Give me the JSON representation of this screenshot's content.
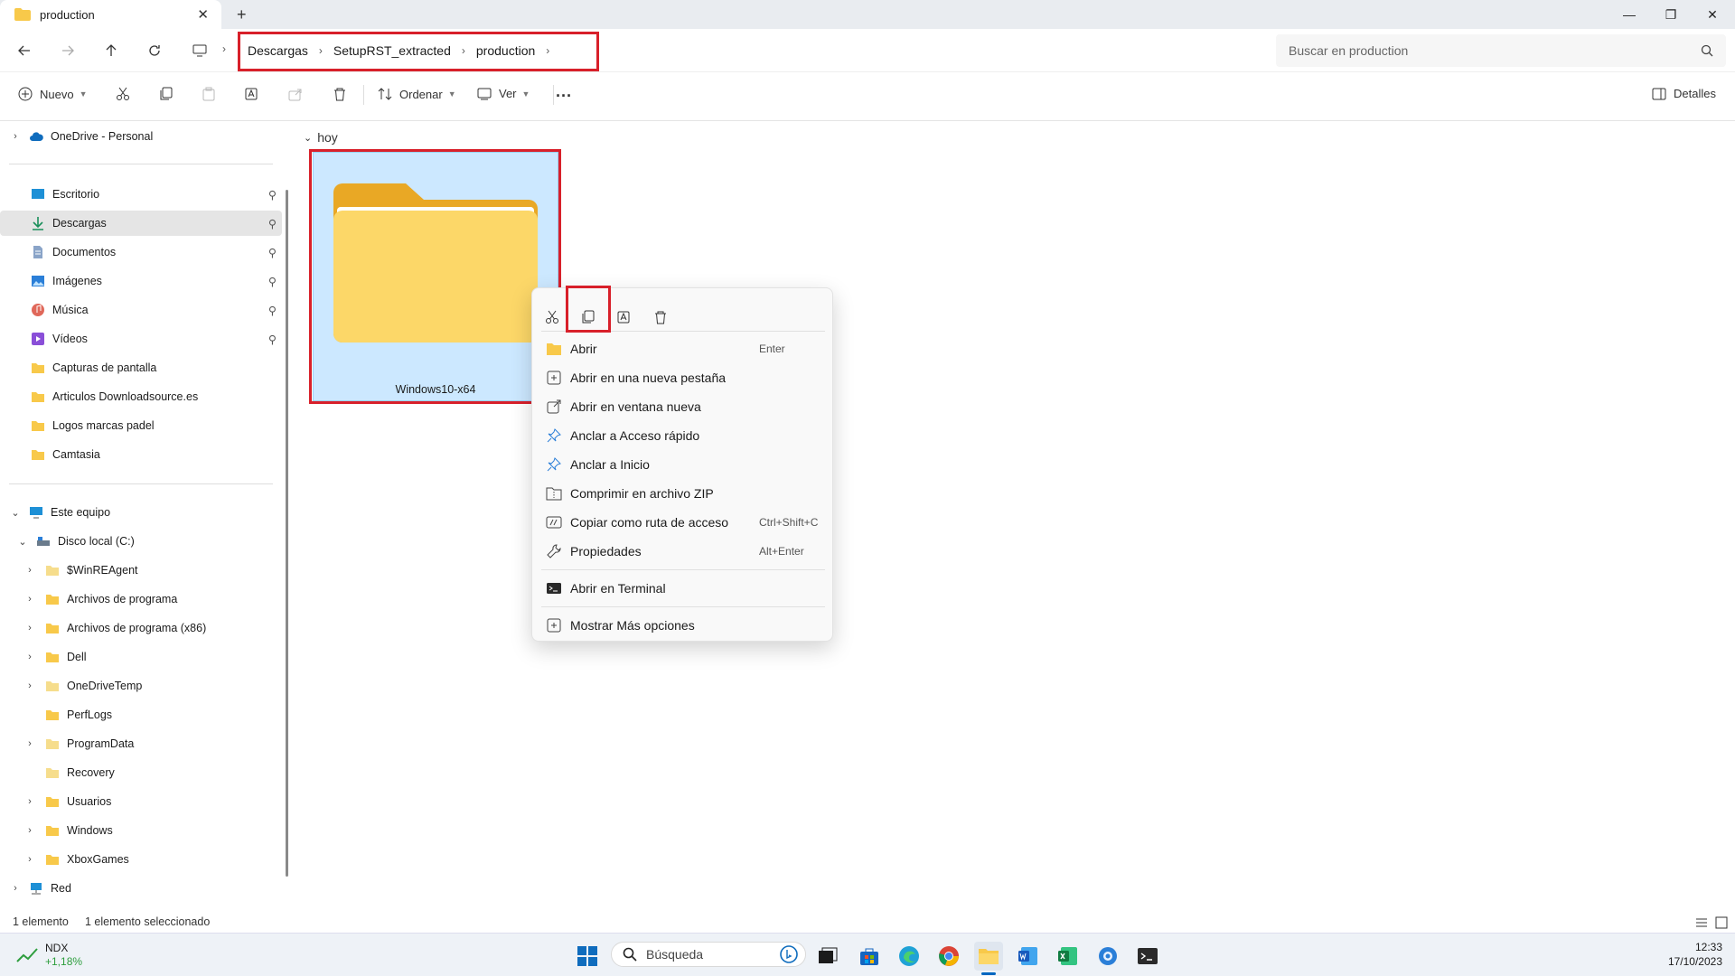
{
  "window": {
    "tab_title": "production",
    "new_tab": "+"
  },
  "breadcrumb": [
    "Descargas",
    "SetupRST_extracted",
    "production"
  ],
  "search": {
    "placeholder": "Buscar en production"
  },
  "toolbar": {
    "new_label": "Nuevo",
    "sort_label": "Ordenar",
    "view_label": "Ver",
    "details_label": "Detalles"
  },
  "sidebar": {
    "onedrive": "OneDrive - Personal",
    "quick": [
      "Escritorio",
      "Descargas",
      "Documentos",
      "Imágenes",
      "Música",
      "Vídeos",
      "Capturas de pantalla",
      "Articulos Downloadsource.es",
      "Logos marcas padel",
      "Camtasia"
    ],
    "this_pc": "Este equipo",
    "drive": "Disco local (C:)",
    "folders": [
      "$WinREAgent",
      "Archivos de programa",
      "Archivos de programa (x86)",
      "Dell",
      "OneDriveTemp",
      "PerfLogs",
      "ProgramData",
      "Recovery",
      "Usuarios",
      "Windows",
      "XboxGames"
    ],
    "network": "Red"
  },
  "content": {
    "group": "hoy",
    "item_name": "Windows10-x64"
  },
  "context_menu": {
    "items": [
      {
        "label": "Abrir",
        "shortcut": "Enter"
      },
      {
        "label": "Abrir en una nueva pestaña",
        "shortcut": ""
      },
      {
        "label": "Abrir en ventana nueva",
        "shortcut": ""
      },
      {
        "label": "Anclar a Acceso rápido",
        "shortcut": ""
      },
      {
        "label": "Anclar a Inicio",
        "shortcut": ""
      },
      {
        "label": "Comprimir en archivo ZIP",
        "shortcut": ""
      },
      {
        "label": "Copiar como ruta de acceso",
        "shortcut": "Ctrl+Shift+C"
      },
      {
        "label": "Propiedades",
        "shortcut": "Alt+Enter"
      }
    ],
    "terminal": "Abrir en Terminal",
    "more": "Mostrar Más opciones"
  },
  "status": {
    "count": "1 elemento",
    "selected": "1 elemento seleccionado"
  },
  "taskbar": {
    "stock_name": "NDX",
    "stock_change": "+1,18%",
    "search_label": "Búsqueda",
    "time": "12:33",
    "date": "17/10/2023"
  },
  "colors": {
    "accent": "#0067c0",
    "highlight_box": "#d8202a",
    "folder": "#f8c94a",
    "selection": "#cce8ff"
  }
}
